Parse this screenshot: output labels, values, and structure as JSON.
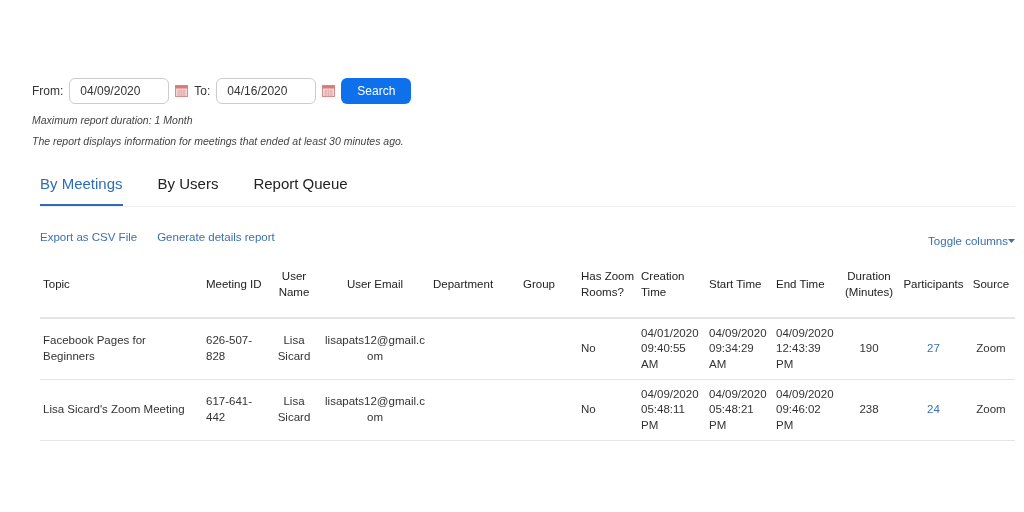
{
  "filters": {
    "from_label": "From:",
    "from_value": "04/09/2020",
    "to_label": "To:",
    "to_value": "04/16/2020",
    "search_button": "Search"
  },
  "notes": [
    "Maximum report duration: 1 Month",
    "The report displays information for meetings that ended at least 30 minutes ago."
  ],
  "tabs": [
    {
      "label": "By Meetings",
      "selected": true
    },
    {
      "label": "By Users",
      "selected": false
    },
    {
      "label": "Report Queue",
      "selected": false
    }
  ],
  "actions": [
    "Export as CSV File",
    "Generate details report"
  ],
  "toggle_columns": "Toggle columns",
  "table": {
    "columns": [
      "Topic",
      "Meeting ID",
      "User Name",
      "User Email",
      "Department",
      "Group",
      "Has Zoom Rooms?",
      "Creation Time",
      "Start Time",
      "End Time",
      "Duration (Minutes)",
      "Participants",
      "Source"
    ],
    "rows": [
      [
        "Facebook Pages for Beginners",
        "626-507-828",
        "Lisa Sicard",
        "lisapats12@gmail.com",
        "",
        "",
        "No",
        "04/01/2020 09:40:55 AM",
        "04/09/2020 09:34:29 AM",
        "04/09/2020 12:43:39 PM",
        "190",
        "27",
        "Zoom"
      ],
      [
        "Lisa Sicard's Zoom Meeting",
        "617-641-442",
        "Lisa Sicard",
        "lisapats12@gmail.com",
        "",
        "",
        "No",
        "04/09/2020 05:48:11 PM",
        "04/09/2020 05:48:21 PM",
        "04/09/2020 09:46:02 PM",
        "238",
        "24",
        "Zoom"
      ]
    ]
  }
}
